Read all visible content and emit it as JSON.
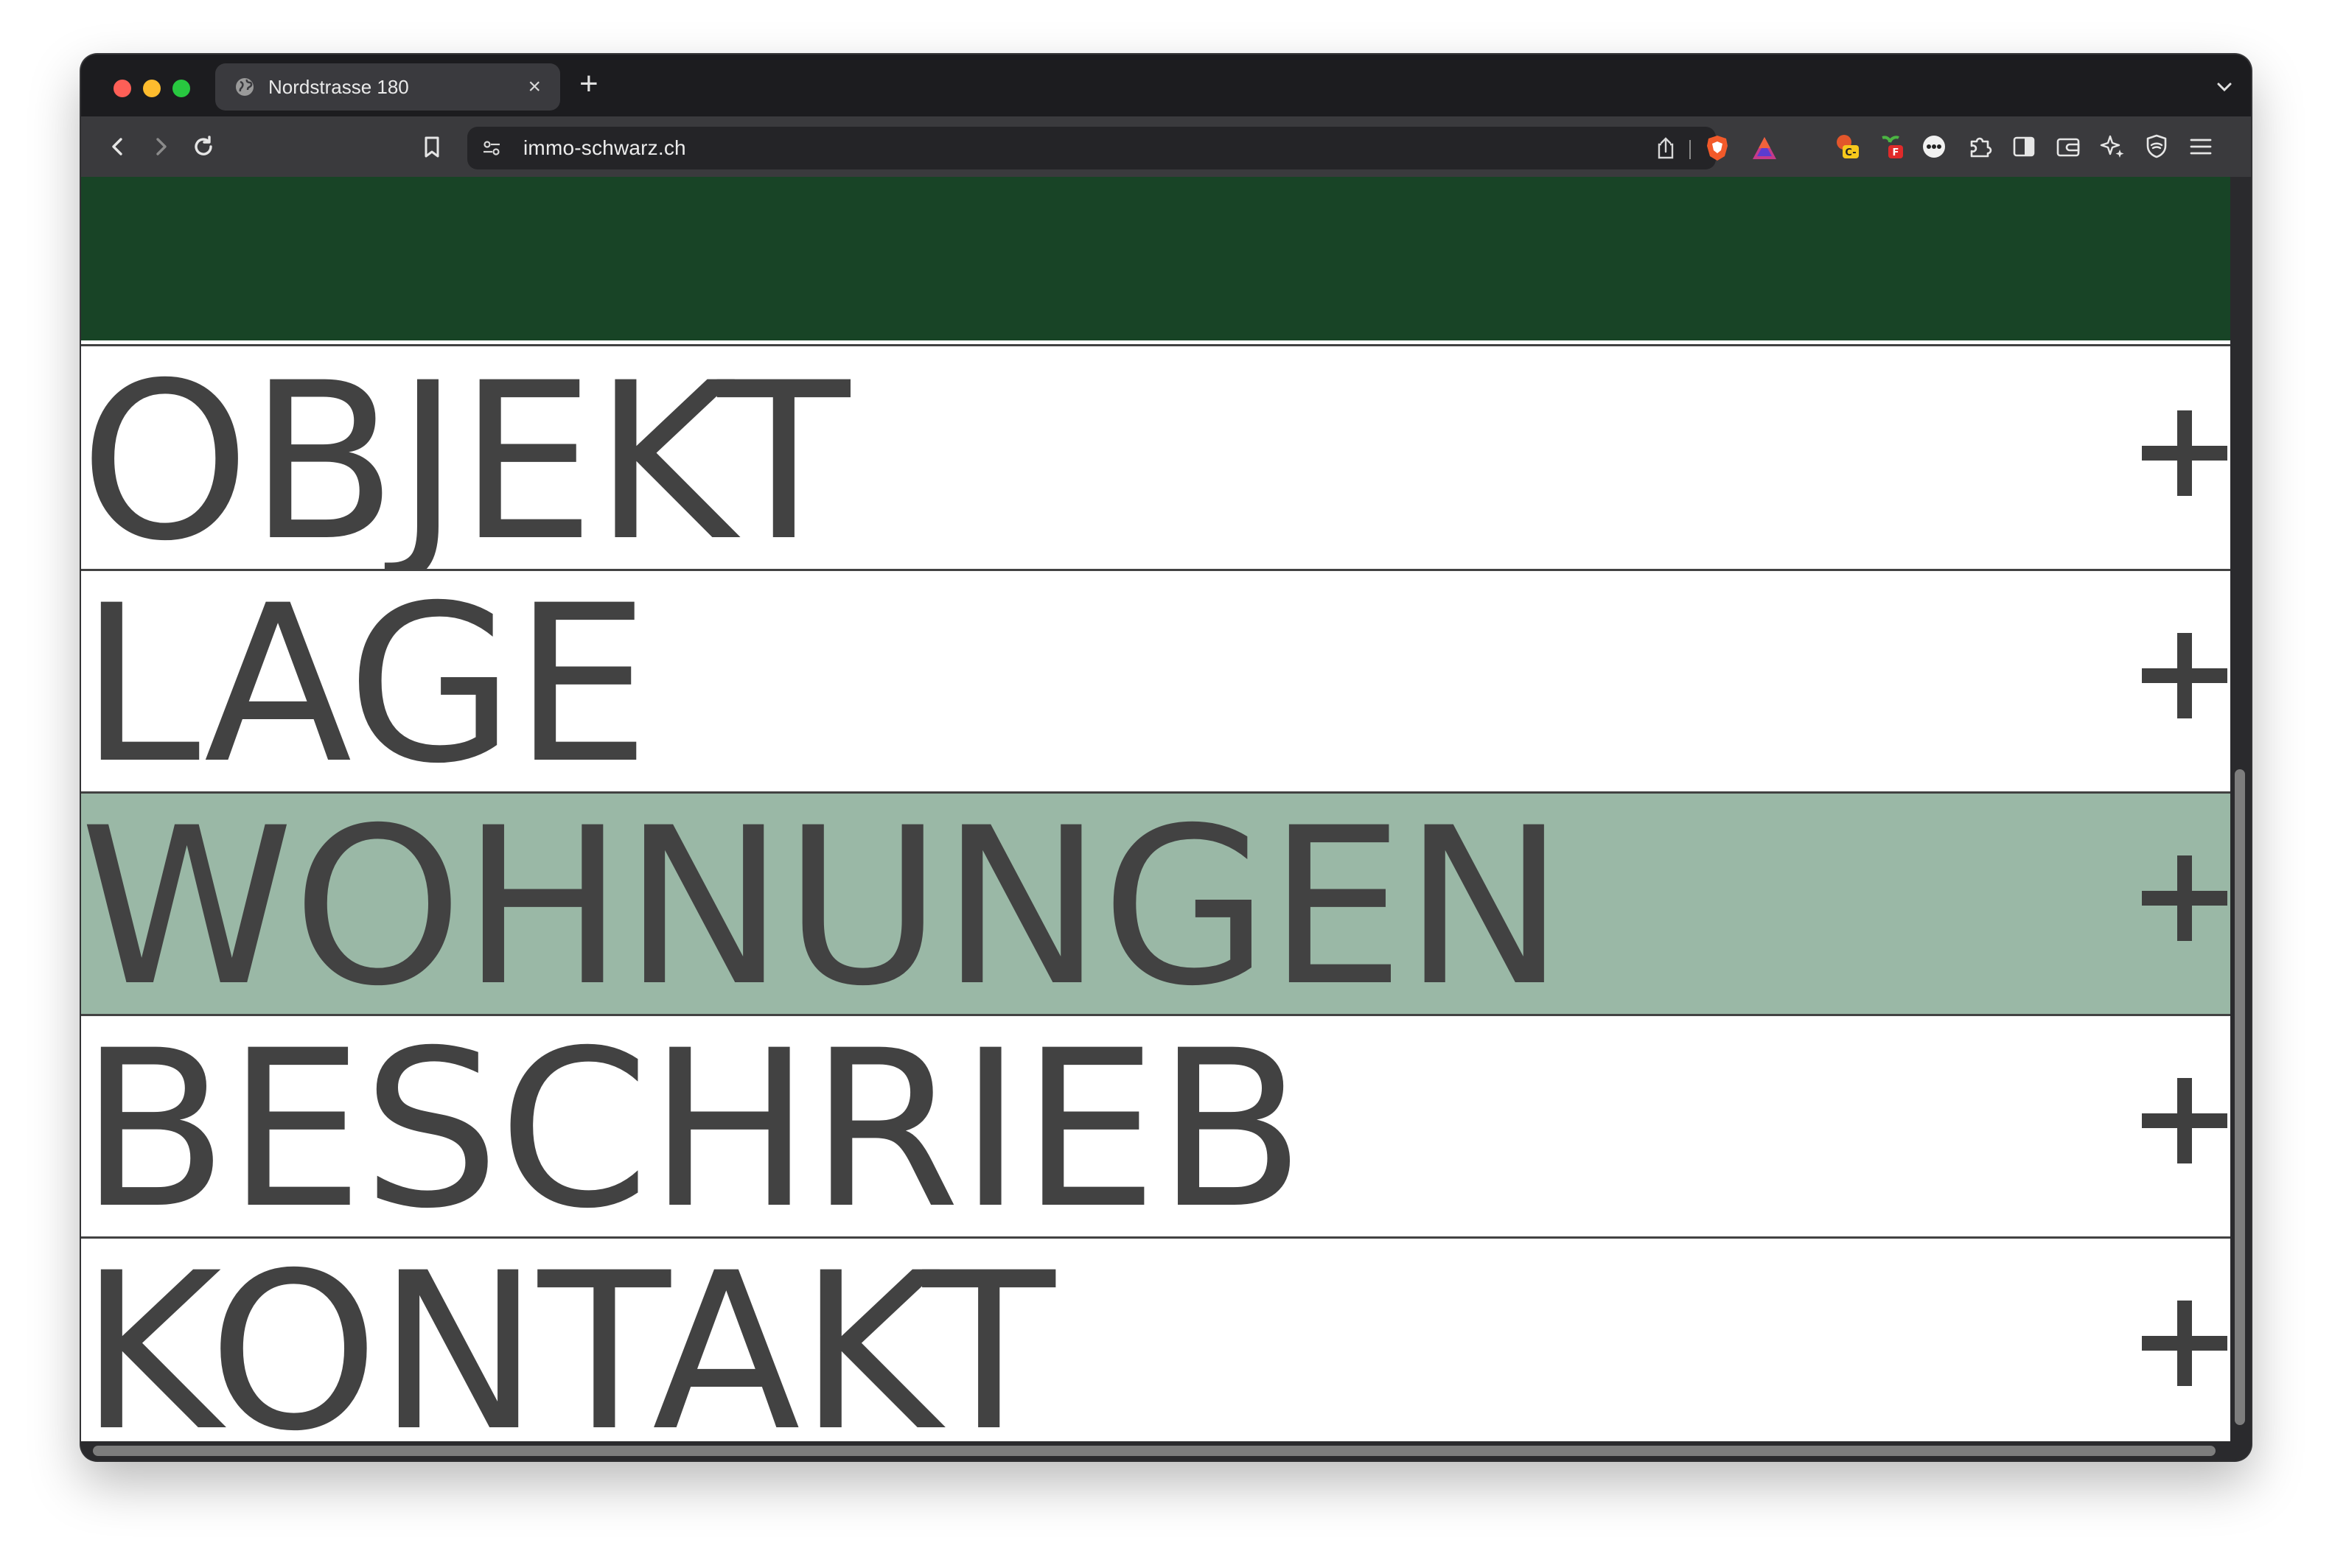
{
  "browser": {
    "tab_title": "Nordstrasse 180",
    "tab_close": "×",
    "new_tab": "+",
    "url": "immo-schwarz.ch",
    "icons": [
      "globe-icon",
      "back-icon",
      "forward-icon",
      "reload-icon",
      "bookmark-icon",
      "site-settings-icon",
      "share-icon",
      "brave-shield-icon",
      "brave-rewards-icon",
      "extension-c-icon",
      "extension-f-icon",
      "extension-dots-icon",
      "extensions-puzzle-icon",
      "sidebar-icon",
      "wallet-icon",
      "leo-ai-icon",
      "vpn-icon",
      "menu-icon"
    ]
  },
  "page": {
    "hero_color": "#184426",
    "accent_color": "#9ab8a6",
    "text_color": "#424242",
    "menu": [
      {
        "label": "OBJEKT",
        "expand": "+",
        "active": false
      },
      {
        "label": "LAGE",
        "expand": "+",
        "active": false
      },
      {
        "label": "WOHNUNGEN",
        "expand": "+",
        "active": true
      },
      {
        "label": "BESCHRIEB",
        "expand": "+",
        "active": false
      },
      {
        "label": "KONTAKT",
        "expand": "+",
        "active": false
      }
    ]
  }
}
